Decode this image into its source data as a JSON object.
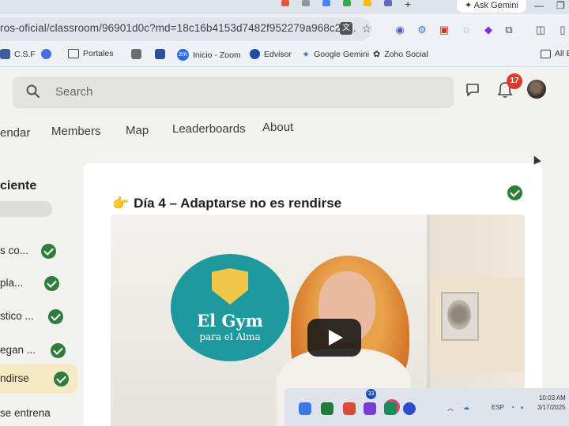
{
  "browser": {
    "ask_gemini_label": "Ask Gemini",
    "url": "ros-oficial/classroom/96901d0c?md=18c16b4153d7482f952279a968c26...",
    "bookmarks": [
      {
        "label": "C.S.F",
        "icon": "csf-icon"
      },
      {
        "label": "",
        "icon": "chrome-icon"
      },
      {
        "label": "Portales",
        "icon": "folder-icon"
      },
      {
        "label": "",
        "icon": "mail-icon"
      },
      {
        "label": "",
        "icon": "school-icon"
      },
      {
        "label": "Inicio - Zoom",
        "icon": "zoom-icon",
        "badge": "zm"
      },
      {
        "label": "Edvisor",
        "icon": "edvisor-icon"
      },
      {
        "label": "Google Gemini",
        "icon": "gemini-icon"
      },
      {
        "label": "Zoho Social",
        "icon": "zoho-icon"
      },
      {
        "label": "All Bo",
        "icon": "folder-icon"
      }
    ]
  },
  "header": {
    "search_placeholder": "Search",
    "notification_count": "17"
  },
  "nav": {
    "tabs": [
      "endar",
      "Members",
      "Map",
      "Leaderboards",
      "About"
    ]
  },
  "sidebar": {
    "heading": "ciente",
    "items": [
      {
        "label": "s co...",
        "done": true
      },
      {
        "label": "pla...",
        "done": true
      },
      {
        "label": "stico ...",
        "done": true
      },
      {
        "label": "egan ...",
        "done": true
      },
      {
        "label": "ndirse",
        "done": true,
        "active": true
      },
      {
        "label": "se entrena",
        "done": false
      }
    ]
  },
  "lesson": {
    "emoji": "👉",
    "title": "Día 4 – Adaptarse no es rendirse",
    "completed": true
  },
  "video": {
    "logo_line1": "El Gym",
    "logo_line2": "para el Alma"
  },
  "taskbar": {
    "badge_count": "33",
    "lang": "ESP",
    "time": "10:03 AM",
    "date": "3/17/2025"
  },
  "colors": {
    "check_green": "#2f7d3b",
    "badge_red": "#e03a2c",
    "active_item": "#f6eac4",
    "logo_teal": "#1e9a9e"
  }
}
